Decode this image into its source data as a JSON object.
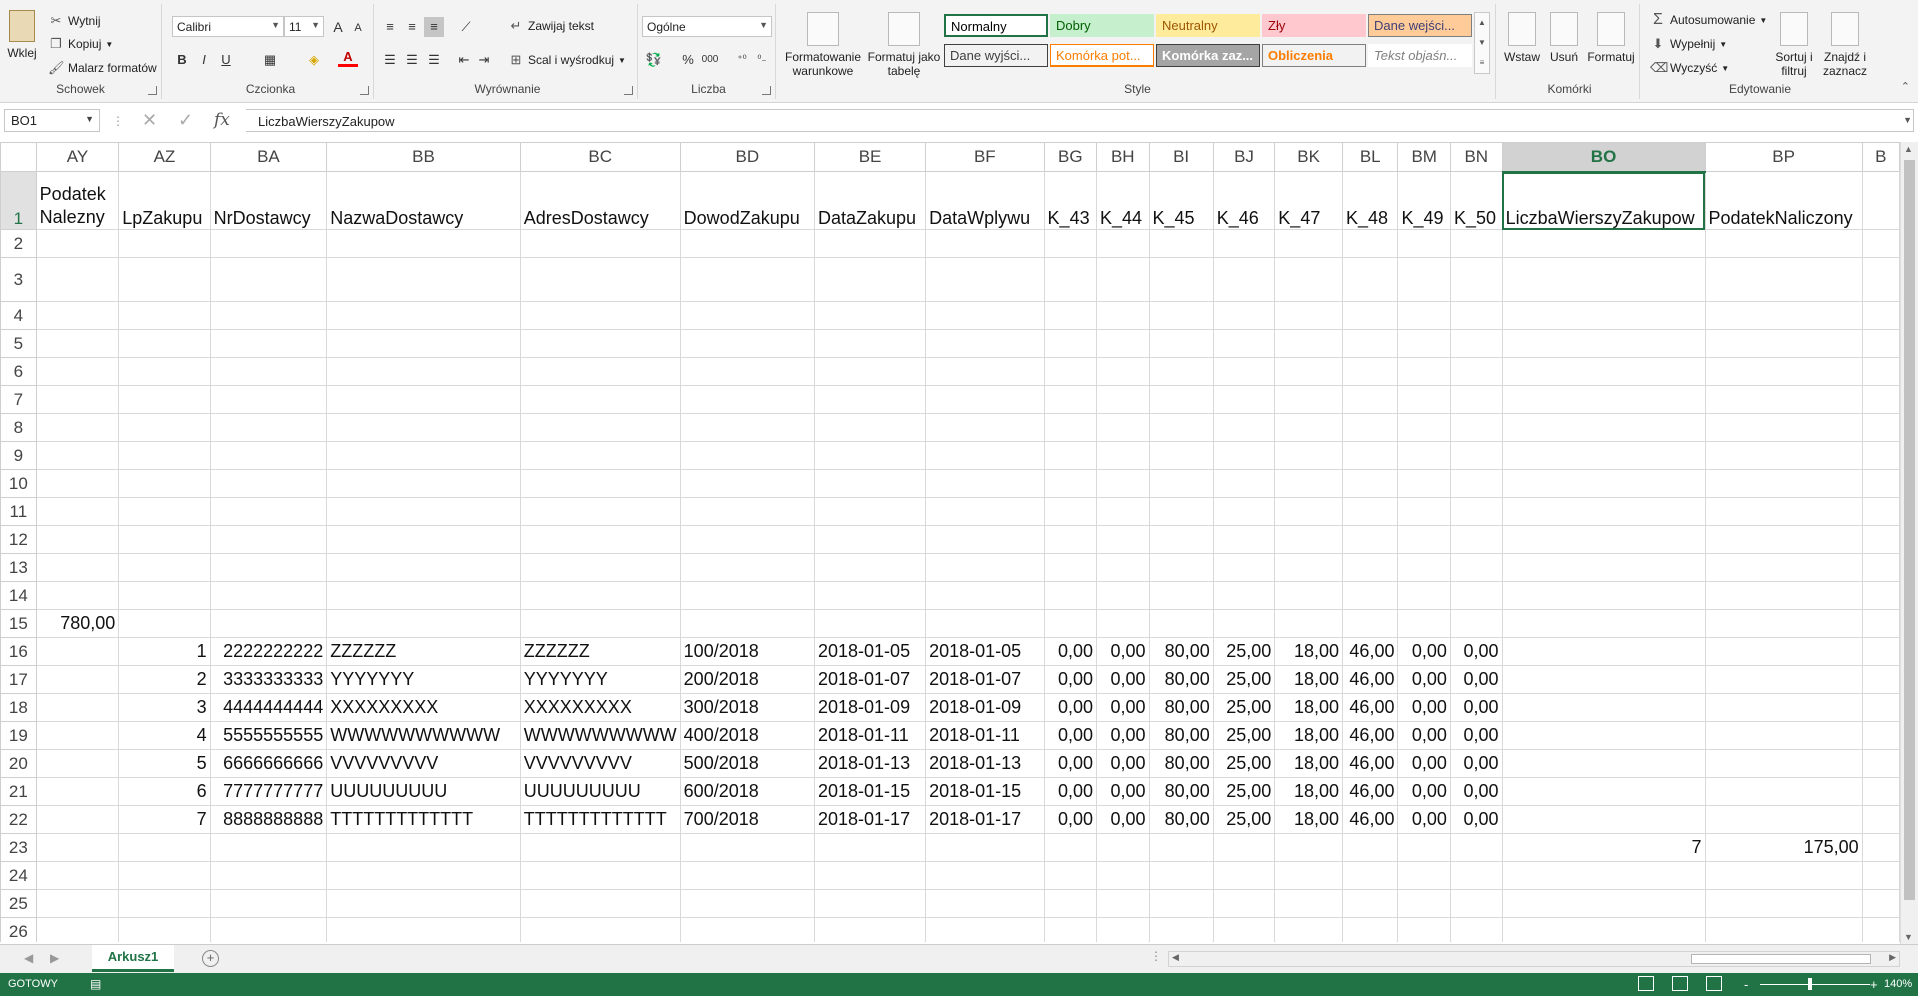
{
  "ribbon": {
    "clipboard": {
      "paste": "Wklej",
      "cut": "Wytnij",
      "copy": "Kopiuj",
      "painter": "Malarz formatów",
      "label": "Schowek"
    },
    "font": {
      "name": "Calibri",
      "size": "11",
      "bold": "B",
      "italic": "I",
      "underline": "U",
      "grow": "A",
      "shrink": "A",
      "font_color": "A",
      "label": "Czcionka"
    },
    "alignment": {
      "wrap": "Zawijaj tekst",
      "merge": "Scal i wyśrodkuj",
      "label": "Wyrównanie"
    },
    "number": {
      "format": "Ogólne",
      "percent": "%",
      "thousands": "000",
      "label": "Liczba"
    },
    "styles": {
      "cond_format": [
        "Formatowanie",
        "warunkowe"
      ],
      "format_table": [
        "Formatuj jako",
        "tabelę"
      ],
      "cells": [
        {
          "text": "Normalny",
          "bg": "#ffffff",
          "color": "#000000",
          "border": "#217346"
        },
        {
          "text": "Dobry",
          "bg": "#c6efce",
          "color": "#006100",
          "border": "#c6efce"
        },
        {
          "text": "Neutralny",
          "bg": "#ffeb9c",
          "color": "#9c5700",
          "border": "#ffeb9c"
        },
        {
          "text": "Zły",
          "bg": "#ffc7ce",
          "color": "#9c0006",
          "border": "#ffc7ce"
        },
        {
          "text": "Dane wejści...",
          "bg": "#ffcc99",
          "color": "#3f3f76",
          "border": "#7f7f7f"
        },
        {
          "text": "Dane wyjści...",
          "bg": "#f2f2f2",
          "color": "#3f3f3f",
          "border": "#3f3f3f"
        },
        {
          "text": "Komórka pot...",
          "bg": "#ffffff",
          "color": "#fa7d00",
          "border": "#fa7d00"
        },
        {
          "text": "Komórka zaz...",
          "bg": "#a5a5a5",
          "color": "#ffffff",
          "border": "#3f3f3f"
        },
        {
          "text": "Obliczenia",
          "bg": "#f2f2f2",
          "color": "#fa7d00",
          "border": "#7f7f7f"
        },
        {
          "text": "Tekst objaśn...",
          "bg": "#ffffff",
          "color": "#7f7f7f",
          "border": "#ffffff"
        }
      ],
      "label": "Style"
    },
    "cells_group": {
      "insert": "Wstaw",
      "delete": "Usuń",
      "format": "Formatuj",
      "label": "Komórki"
    },
    "editing": {
      "autosum": "Autosumowanie",
      "fill": "Wypełnij",
      "clear": "Wyczyść",
      "sort": [
        "Sortuj i",
        "filtruj"
      ],
      "find": [
        "Znajdź i",
        "zaznacz"
      ],
      "label": "Edytowanie"
    }
  },
  "formula_bar": {
    "name_box": "BO1",
    "fx": "fx",
    "content": "LiczbaWierszyZakupow"
  },
  "grid": {
    "selected_column": "BO",
    "columns": [
      {
        "id": "AY",
        "w": 84
      },
      {
        "id": "AZ",
        "w": 92
      },
      {
        "id": "BA",
        "w": 118
      },
      {
        "id": "BB",
        "w": 196
      },
      {
        "id": "BC",
        "w": 146
      },
      {
        "id": "BD",
        "w": 136
      },
      {
        "id": "BE",
        "w": 112
      },
      {
        "id": "BF",
        "w": 120
      },
      {
        "id": "BG",
        "w": 53
      },
      {
        "id": "BH",
        "w": 53
      },
      {
        "id": "BI",
        "w": 66
      },
      {
        "id": "BJ",
        "w": 63
      },
      {
        "id": "BK",
        "w": 70
      },
      {
        "id": "BL",
        "w": 56
      },
      {
        "id": "BM",
        "w": 53
      },
      {
        "id": "BN",
        "w": 52
      },
      {
        "id": "BO",
        "w": 204
      },
      {
        "id": "BP",
        "w": 158
      },
      {
        "id": "B",
        "w": 40
      }
    ],
    "rows": [
      {
        "n": "1",
        "cells": [
          "Podatek Nalezny",
          "LpZakupu",
          "NrDostawcy",
          "NazwaDostawcy",
          "AdresDostawcy",
          "DowodZakupu",
          "DataZakupu",
          "DataWplywu",
          "K_43",
          "K_44",
          "K_45",
          "K_46",
          "K_47",
          "K_48",
          "K_49",
          "K_50",
          "LiczbaWierszyZakupow",
          "PodatekNaliczony",
          ""
        ]
      },
      {
        "n": "2",
        "cells": [
          "",
          "",
          "",
          "",
          "",
          "",
          "",
          "",
          "",
          "",
          "",
          "",
          "",
          "",
          "",
          "",
          "",
          "",
          ""
        ]
      },
      {
        "n": "3",
        "cells": [
          "",
          "",
          "",
          "",
          "",
          "",
          "",
          "",
          "",
          "",
          "",
          "",
          "",
          "",
          "",
          "",
          "",
          "",
          ""
        ]
      },
      {
        "n": "4",
        "cells": [
          "",
          "",
          "",
          "",
          "",
          "",
          "",
          "",
          "",
          "",
          "",
          "",
          "",
          "",
          "",
          "",
          "",
          "",
          ""
        ]
      },
      {
        "n": "5",
        "cells": [
          "",
          "",
          "",
          "",
          "",
          "",
          "",
          "",
          "",
          "",
          "",
          "",
          "",
          "",
          "",
          "",
          "",
          "",
          ""
        ]
      },
      {
        "n": "6",
        "cells": [
          "",
          "",
          "",
          "",
          "",
          "",
          "",
          "",
          "",
          "",
          "",
          "",
          "",
          "",
          "",
          "",
          "",
          "",
          ""
        ]
      },
      {
        "n": "7",
        "cells": [
          "",
          "",
          "",
          "",
          "",
          "",
          "",
          "",
          "",
          "",
          "",
          "",
          "",
          "",
          "",
          "",
          "",
          "",
          ""
        ]
      },
      {
        "n": "8",
        "cells": [
          "",
          "",
          "",
          "",
          "",
          "",
          "",
          "",
          "",
          "",
          "",
          "",
          "",
          "",
          "",
          "",
          "",
          "",
          ""
        ]
      },
      {
        "n": "9",
        "cells": [
          "",
          "",
          "",
          "",
          "",
          "",
          "",
          "",
          "",
          "",
          "",
          "",
          "",
          "",
          "",
          "",
          "",
          "",
          ""
        ]
      },
      {
        "n": "10",
        "cells": [
          "",
          "",
          "",
          "",
          "",
          "",
          "",
          "",
          "",
          "",
          "",
          "",
          "",
          "",
          "",
          "",
          "",
          "",
          ""
        ]
      },
      {
        "n": "11",
        "cells": [
          "",
          "",
          "",
          "",
          "",
          "",
          "",
          "",
          "",
          "",
          "",
          "",
          "",
          "",
          "",
          "",
          "",
          "",
          ""
        ]
      },
      {
        "n": "12",
        "cells": [
          "",
          "",
          "",
          "",
          "",
          "",
          "",
          "",
          "",
          "",
          "",
          "",
          "",
          "",
          "",
          "",
          "",
          "",
          ""
        ]
      },
      {
        "n": "13",
        "cells": [
          "",
          "",
          "",
          "",
          "",
          "",
          "",
          "",
          "",
          "",
          "",
          "",
          "",
          "",
          "",
          "",
          "",
          "",
          ""
        ]
      },
      {
        "n": "14",
        "cells": [
          "",
          "",
          "",
          "",
          "",
          "",
          "",
          "",
          "",
          "",
          "",
          "",
          "",
          "",
          "",
          "",
          "",
          "",
          ""
        ]
      },
      {
        "n": "15",
        "cells": [
          "780,00",
          "",
          "",
          "",
          "",
          "",
          "",
          "",
          "",
          "",
          "",
          "",
          "",
          "",
          "",
          "",
          "",
          "",
          ""
        ]
      },
      {
        "n": "16",
        "cells": [
          "",
          "1",
          "2222222222",
          "ZZZZZZ",
          "ZZZZZZ",
          "100/2018",
          "2018-01-05",
          "2018-01-05",
          "0,00",
          "0,00",
          "80,00",
          "25,00",
          "18,00",
          "46,00",
          "0,00",
          "0,00",
          "",
          "",
          ""
        ]
      },
      {
        "n": "17",
        "cells": [
          "",
          "2",
          "3333333333",
          "YYYYYYY",
          "YYYYYYY",
          "200/2018",
          "2018-01-07",
          "2018-01-07",
          "0,00",
          "0,00",
          "80,00",
          "25,00",
          "18,00",
          "46,00",
          "0,00",
          "0,00",
          "",
          "",
          ""
        ]
      },
      {
        "n": "18",
        "cells": [
          "",
          "3",
          "4444444444",
          "XXXXXXXXX",
          "XXXXXXXXX",
          "300/2018",
          "2018-01-09",
          "2018-01-09",
          "0,00",
          "0,00",
          "80,00",
          "25,00",
          "18,00",
          "46,00",
          "0,00",
          "0,00",
          "",
          "",
          ""
        ]
      },
      {
        "n": "19",
        "cells": [
          "",
          "4",
          "5555555555",
          "WWWWWWWWWW",
          "WWWWWWWWW",
          "400/2018",
          "2018-01-11",
          "2018-01-11",
          "0,00",
          "0,00",
          "80,00",
          "25,00",
          "18,00",
          "46,00",
          "0,00",
          "0,00",
          "",
          "",
          ""
        ]
      },
      {
        "n": "20",
        "cells": [
          "",
          "5",
          "6666666666",
          "VVVVVVVVV",
          "VVVVVVVVV",
          "500/2018",
          "2018-01-13",
          "2018-01-13",
          "0,00",
          "0,00",
          "80,00",
          "25,00",
          "18,00",
          "46,00",
          "0,00",
          "0,00",
          "",
          "",
          ""
        ]
      },
      {
        "n": "21",
        "cells": [
          "",
          "6",
          "7777777777",
          "UUUUUUUUU",
          "UUUUUUUUU",
          "600/2018",
          "2018-01-15",
          "2018-01-15",
          "0,00",
          "0,00",
          "80,00",
          "25,00",
          "18,00",
          "46,00",
          "0,00",
          "0,00",
          "",
          "",
          ""
        ]
      },
      {
        "n": "22",
        "cells": [
          "",
          "7",
          "8888888888",
          "TTTTTTTTTTTTT",
          "TTTTTTTTTTTTT",
          "700/2018",
          "2018-01-17",
          "2018-01-17",
          "0,00",
          "0,00",
          "80,00",
          "25,00",
          "18,00",
          "46,00",
          "0,00",
          "0,00",
          "",
          "",
          ""
        ]
      },
      {
        "n": "23",
        "cells": [
          "",
          "",
          "",
          "",
          "",
          "",
          "",
          "",
          "",
          "",
          "",
          "",
          "",
          "",
          "",
          "",
          "7",
          "175,00",
          ""
        ]
      },
      {
        "n": "24",
        "cells": [
          "",
          "",
          "",
          "",
          "",
          "",
          "",
          "",
          "",
          "",
          "",
          "",
          "",
          "",
          "",
          "",
          "",
          "",
          ""
        ]
      },
      {
        "n": "25",
        "cells": [
          "",
          "",
          "",
          "",
          "",
          "",
          "",
          "",
          "",
          "",
          "",
          "",
          "",
          "",
          "",
          "",
          "",
          "",
          ""
        ]
      },
      {
        "n": "26",
        "cells": [
          "",
          "",
          "",
          "",
          "",
          "",
          "",
          "",
          "",
          "",
          "",
          "",
          "",
          "",
          "",
          "",
          "",
          "",
          ""
        ]
      }
    ]
  },
  "sheet_tabs": {
    "active": "Arkusz1",
    "add": "+"
  },
  "status_bar": {
    "ready": "GOTOWY",
    "zoom": "140%",
    "zoom_minus": "-",
    "zoom_plus": "+"
  },
  "colors": {
    "accent": "#217346",
    "ribbon_bg": "#f3f3f3",
    "header_selected_bg": "#d2d2d2"
  }
}
